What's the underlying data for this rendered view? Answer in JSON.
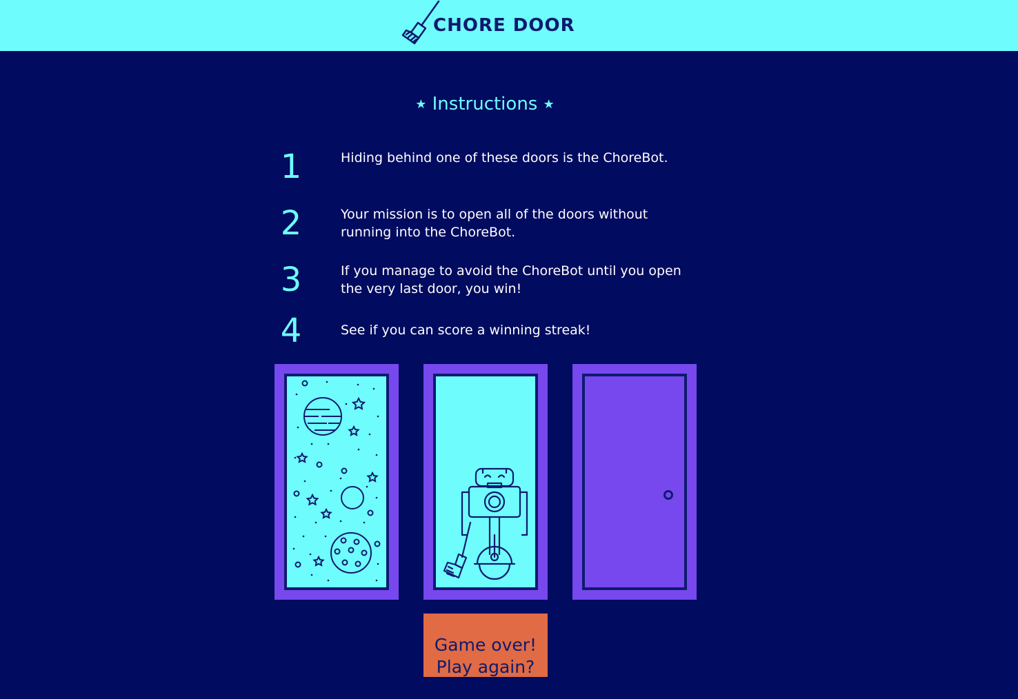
{
  "header": {
    "title": "CHORE DOOR",
    "logo_icon": "broom-icon"
  },
  "instructions": {
    "title": "Instructions",
    "star_glyph": "★",
    "steps": [
      {
        "number": "1",
        "text": "Hiding behind one of these doors is the ChoreBot."
      },
      {
        "number": "2",
        "text": "Your mission is to open all of the doors without running into the ChoreBot."
      },
      {
        "number": "3",
        "text": "If you manage to avoid the ChoreBot until you open the very last door, you win!"
      },
      {
        "number": "4",
        "text": "See if you can score a winning streak!"
      }
    ]
  },
  "doors": [
    {
      "state": "open",
      "content": "space-icon"
    },
    {
      "state": "open",
      "content": "chorebot-icon"
    },
    {
      "state": "closed",
      "content": "door-knob-icon"
    }
  ],
  "start_button": {
    "label": "Game over! Play again?"
  },
  "colors": {
    "background": "#010b5f",
    "header": "#6efcfd",
    "door": "#7748ee",
    "accent": "#6efcfd",
    "button": "#e06b44",
    "ink": "#0f1a6e"
  }
}
